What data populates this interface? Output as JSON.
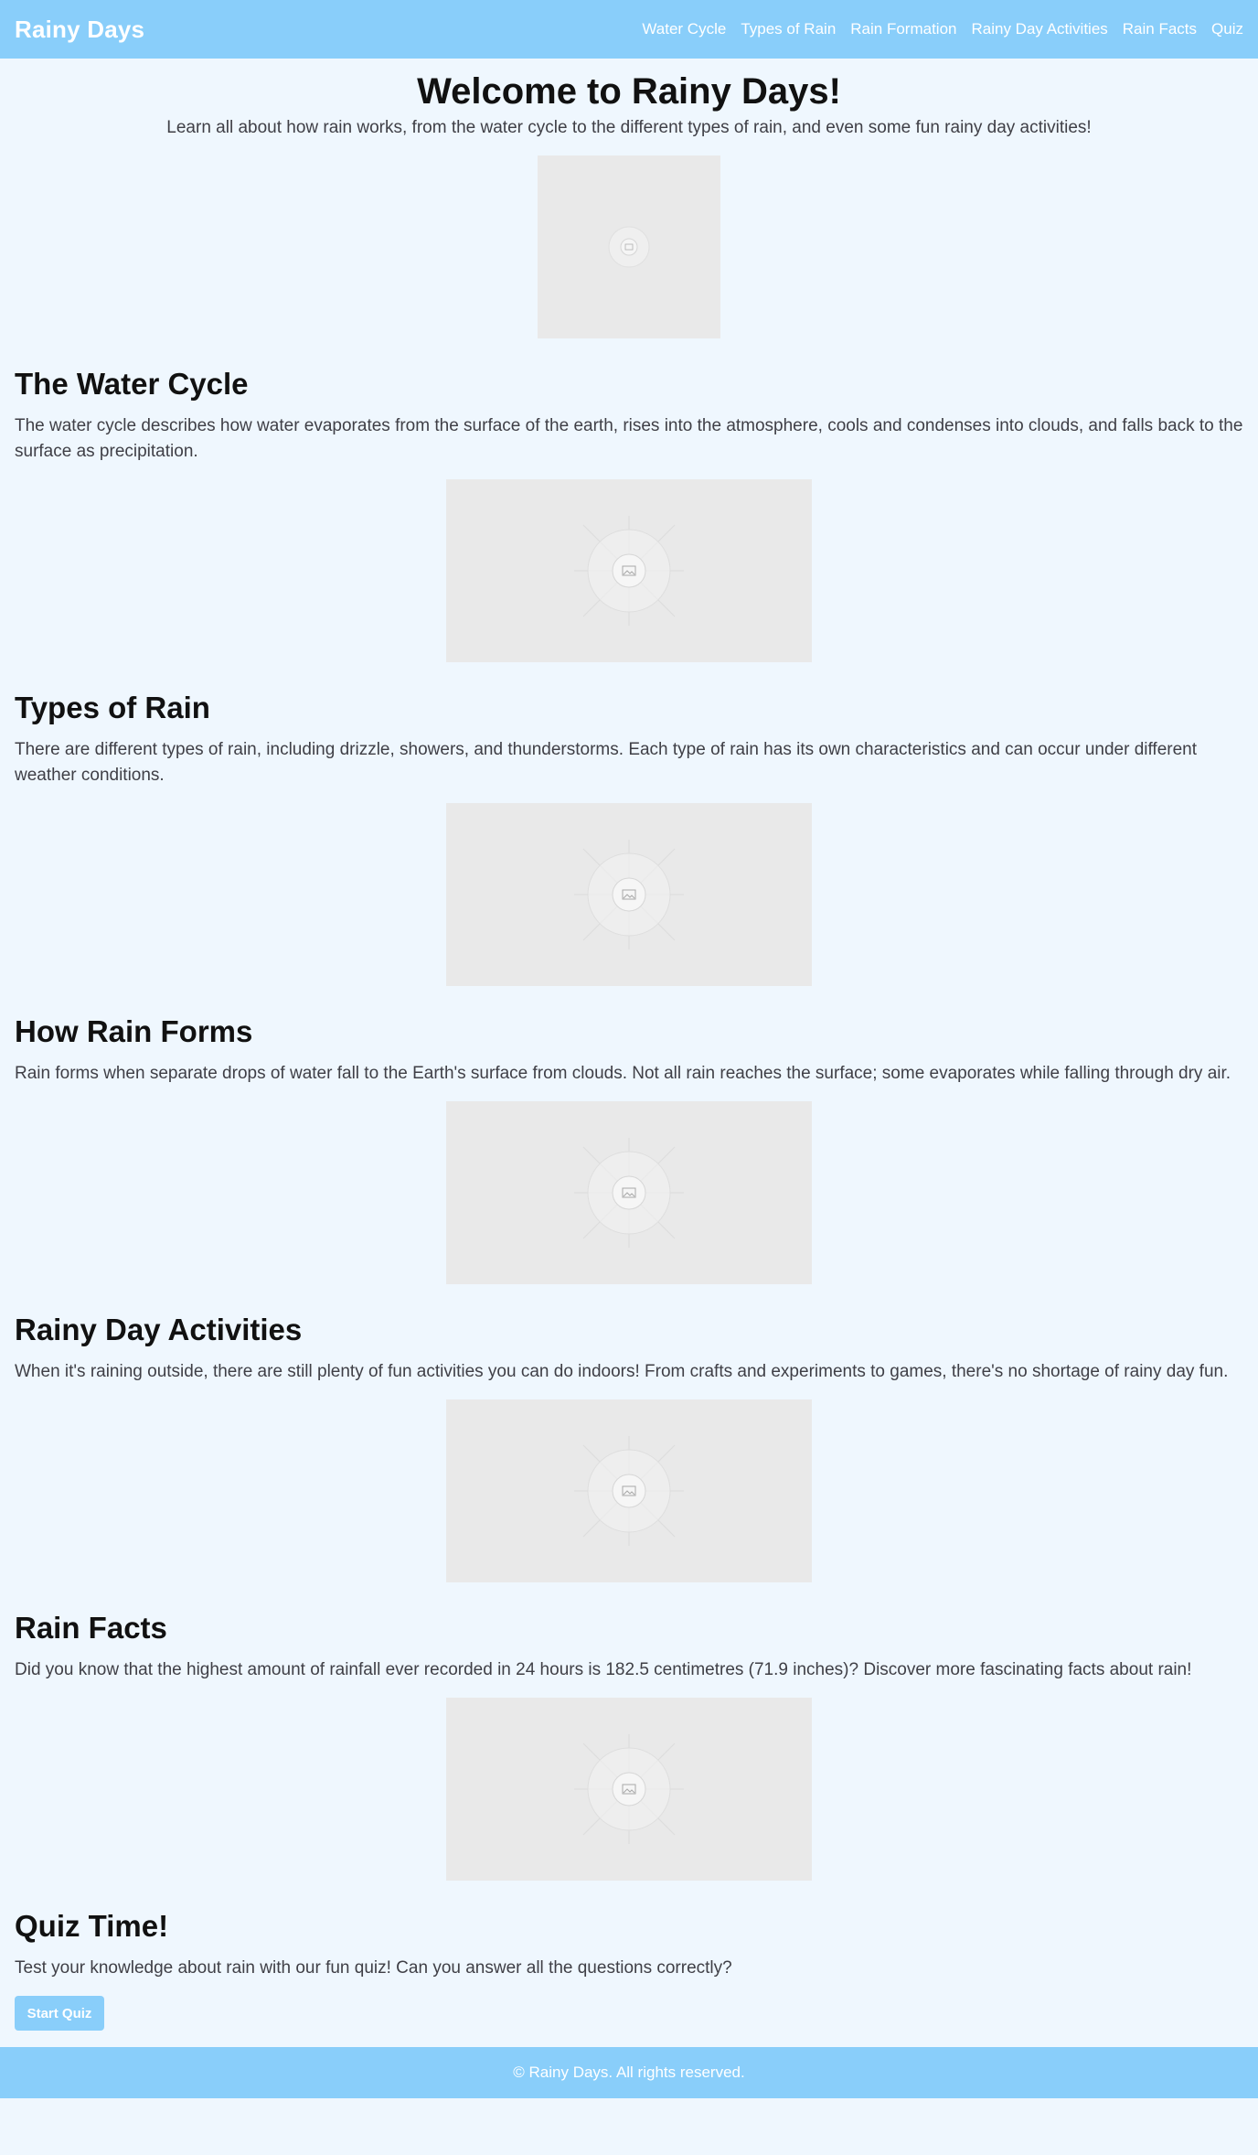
{
  "header": {
    "brand": "Rainy Days",
    "nav": [
      "Water Cycle",
      "Types of Rain",
      "Rain Formation",
      "Rainy Day Activities",
      "Rain Facts",
      "Quiz"
    ]
  },
  "hero": {
    "title": "Welcome to Rainy Days!",
    "subtitle": "Learn all about how rain works, from the water cycle to the different types of rain, and even some fun rainy day activities!",
    "image_icon": "image-placeholder-icon"
  },
  "sections": [
    {
      "title": "The Water Cycle",
      "text": "The water cycle describes how water evaporates from the surface of the earth, rises into the atmosphere, cools and condenses into clouds, and falls back to the surface as precipitation.",
      "image_icon": "image-placeholder-icon"
    },
    {
      "title": "Types of Rain",
      "text": "There are different types of rain, including drizzle, showers, and thunderstorms. Each type of rain has its own characteristics and can occur under different weather conditions.",
      "image_icon": "image-placeholder-icon"
    },
    {
      "title": "How Rain Forms",
      "text": "Rain forms when separate drops of water fall to the Earth's surface from clouds. Not all rain reaches the surface; some evaporates while falling through dry air.",
      "image_icon": "image-placeholder-icon"
    },
    {
      "title": "Rainy Day Activities",
      "text": "When it's raining outside, there are still plenty of fun activities you can do indoors! From crafts and experiments to games, there's no shortage of rainy day fun.",
      "image_icon": "image-placeholder-icon"
    },
    {
      "title": "Rain Facts",
      "text": "Did you know that the highest amount of rainfall ever recorded in 24 hours is 182.5 centimetres (71.9 inches)? Discover more fascinating facts about rain!",
      "image_icon": "image-placeholder-icon"
    }
  ],
  "quiz": {
    "title": "Quiz Time!",
    "text": "Test your knowledge about rain with our fun quiz! Can you answer all the questions correctly?",
    "button": "Start Quiz"
  },
  "footer": {
    "text": "© Rainy Days. All rights reserved."
  },
  "colors": {
    "accent": "#89cefa",
    "background": "#eff7fe",
    "placeholder": "#e9e9e9"
  }
}
